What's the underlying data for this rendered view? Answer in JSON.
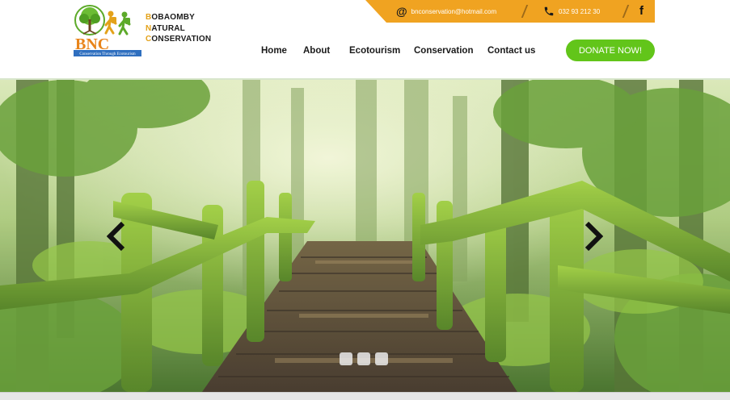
{
  "brand": {
    "logo_letters": "BNC",
    "logo_tagline": "Conservation Through Ecotourism",
    "name_lines": [
      {
        "first": "B",
        "rest": "OBAOMBY"
      },
      {
        "first": "N",
        "rest": "ATURAL"
      },
      {
        "first": "C",
        "rest": "ONSERVATION"
      }
    ]
  },
  "contact": {
    "email": "bnconservation@hotmail.com",
    "phone": "032 93 212 30",
    "email_icon": "at-icon",
    "phone_icon": "phone-icon",
    "social_icon": "facebook-icon",
    "social_glyph": "f",
    "bar_color": "#f0a321"
  },
  "nav": {
    "items": [
      "Home",
      "About",
      "Ecotourism",
      "Conservation",
      "Contact us"
    ],
    "donate_label": "DONATE NOW!",
    "donate_color": "#62c51a"
  },
  "slider": {
    "prev_icon": "chevron-left-icon",
    "next_icon": "chevron-right-icon",
    "slide_count": 3
  }
}
